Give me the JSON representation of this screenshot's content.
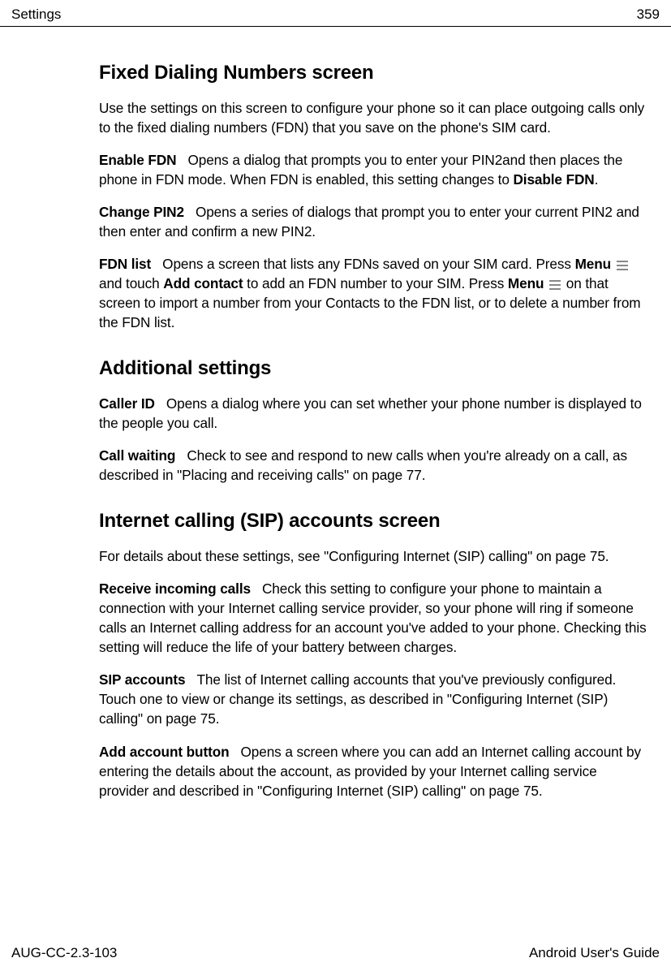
{
  "header": {
    "section": "Settings",
    "page_number": "359"
  },
  "sections": [
    {
      "heading": "Fixed Dialing Numbers screen",
      "intro": "Use the settings on this screen to configure your phone so it can place outgoing calls only to the fixed dialing numbers (FDN) that you save on the phone's SIM card.",
      "items": [
        {
          "label": "Enable FDN",
          "text_before": "Opens a dialog that prompts you to enter your PIN2and then places the phone in FDN mode. When FDN is enabled, this setting changes to ",
          "bold_inline": "Disable FDN",
          "text_after": "."
        },
        {
          "label": "Change PIN2",
          "text": "Opens a series of dialogs that prompt you to enter your current PIN2 and then enter and confirm a new PIN2."
        },
        {
          "label": "FDN list",
          "p1": "Opens a screen that lists any FDNs saved on your SIM card. Press ",
          "menu1": "Menu",
          "p2": " and touch ",
          "add_contact": "Add contact",
          "p3": " to add an FDN number to your SIM. Press ",
          "menu2": "Menu",
          "p4": " on that screen to import a number from your Contacts to the FDN list, or to delete a number from the FDN list."
        }
      ]
    },
    {
      "heading": "Additional settings",
      "items": [
        {
          "label": "Caller ID",
          "text": "Opens a dialog where you can set whether your phone number is displayed to the people you call."
        },
        {
          "label": "Call waiting",
          "text": "Check to see and respond to new calls when you're already on a call, as described in \"Placing and receiving calls\" on page 77."
        }
      ]
    },
    {
      "heading": "Internet calling (SIP) accounts screen",
      "intro": "For details about these settings, see \"Configuring Internet (SIP) calling\" on page 75.",
      "items": [
        {
          "label": "Receive incoming calls",
          "text": "Check this setting to configure your phone to maintain a connection with your Internet calling service provider, so your phone will ring if someone calls an Internet calling address for an account you've added to your phone. Checking this setting will reduce the life of your battery between charges."
        },
        {
          "label": "SIP accounts",
          "text": "The list of Internet calling accounts that you've previously configured. Touch one to view or change its settings, as described in \"Configuring Internet (SIP) calling\" on page 75."
        },
        {
          "label": "Add account button",
          "text": "Opens a screen where you can add an Internet calling account by entering the details about the account, as provided by your Internet calling service provider and described in \"Configuring Internet (SIP) calling\" on page 75."
        }
      ]
    }
  ],
  "footer": {
    "doc_id": "AUG-CC-2.3-103",
    "guide": "Android User's Guide"
  }
}
